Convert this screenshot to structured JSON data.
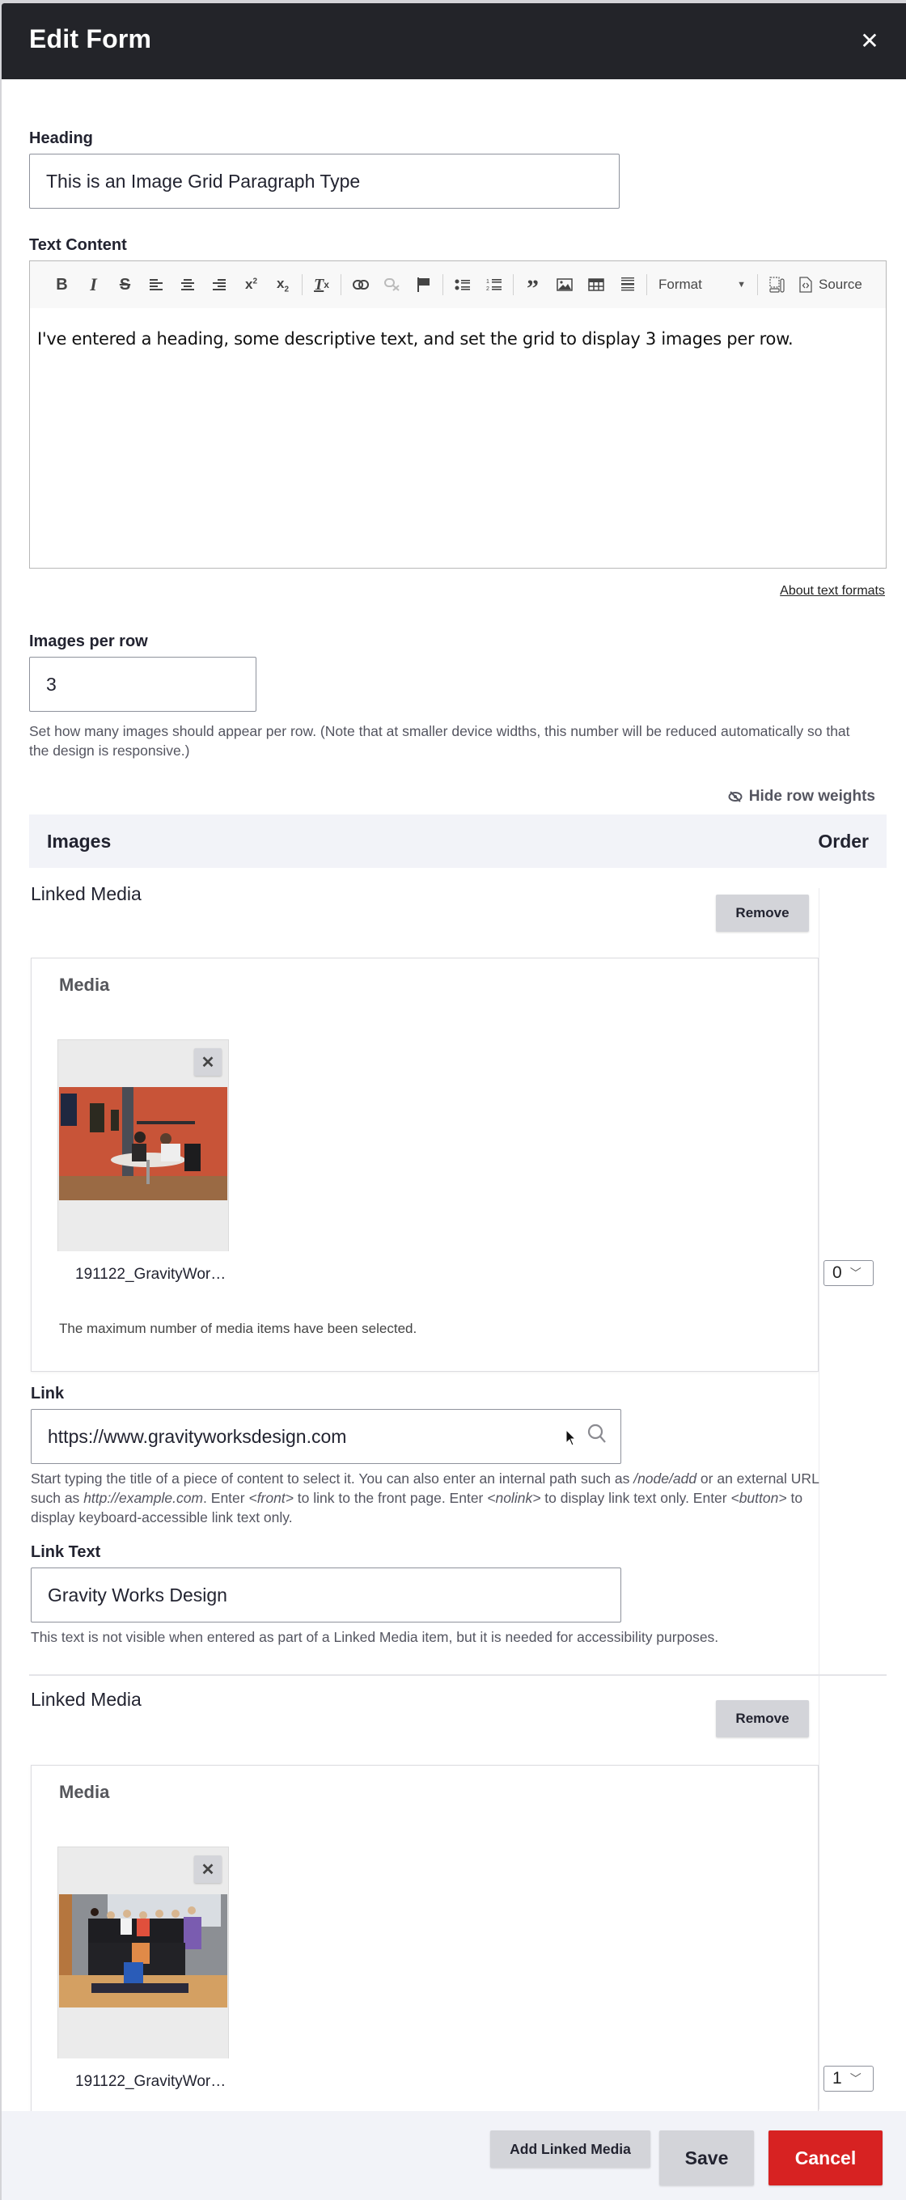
{
  "dialog": {
    "title": "Edit Form",
    "close_icon": "close-icon"
  },
  "heading": {
    "label": "Heading",
    "value": "This is an Image Grid Paragraph Type"
  },
  "text_content": {
    "label": "Text Content",
    "toolbar": [
      {
        "name": "bold",
        "glyph": "B"
      },
      {
        "name": "italic",
        "glyph": "I"
      },
      {
        "name": "strikethrough",
        "glyph": "S"
      },
      {
        "name": "align-left",
        "glyph": "≡"
      },
      {
        "name": "align-center",
        "glyph": "≡"
      },
      {
        "name": "align-right",
        "glyph": "≡"
      },
      {
        "name": "superscript",
        "glyph": "x²"
      },
      {
        "name": "subscript",
        "glyph": "x₂"
      },
      {
        "name": "remove-format",
        "glyph": "Tx"
      },
      {
        "name": "link",
        "glyph": "🔗"
      },
      {
        "name": "unlink",
        "glyph": "⛓"
      },
      {
        "name": "anchor",
        "glyph": "⚑"
      },
      {
        "name": "bulleted-list",
        "glyph": "•≡"
      },
      {
        "name": "numbered-list",
        "glyph": "1≡"
      },
      {
        "name": "blockquote",
        "glyph": "❞"
      },
      {
        "name": "image",
        "glyph": "▨"
      },
      {
        "name": "table",
        "glyph": "▦"
      },
      {
        "name": "horizontal-line",
        "glyph": "☰"
      }
    ],
    "format_label": "Format",
    "source_label": "Source",
    "body": "I've entered a heading, some descriptive text, and set the grid to display 3 images per row.",
    "about_link": "About text formats"
  },
  "images_per_row": {
    "label": "Images per row",
    "value": "3",
    "description": "Set how many images should appear per row. (Note that at smaller device widths, this number will be reduced automatically so that the design is responsive.)"
  },
  "images_table": {
    "hide_weights_label": "Hide row weights",
    "col_images": "Images",
    "col_order": "Order",
    "items": [
      {
        "type_label": "Linked Media",
        "remove_label": "Remove",
        "media_title": "Media",
        "thumb_name": "191122_GravityWor…",
        "remove_media_glyph": "✕",
        "max_note": "The maximum number of media items have been selected.",
        "order": "0",
        "link_label": "Link",
        "link_value": "https://www.gravityworksdesign.com",
        "link_desc_parts": {
          "p1": "Start typing the title of a piece of content to select it. You can also enter an internal path such as ",
          "i1": "/node/add",
          "p2": " or an external URL such as ",
          "i2": "http://example.com",
          "p3": ". Enter ",
          "i3": "<front>",
          "p4": " to link to the front page. Enter ",
          "i4": "<nolink>",
          "p5": " to display link text only. Enter ",
          "i5": "<button>",
          "p6": " to display keyboard-accessible link text only."
        },
        "link_text_label": "Link Text",
        "link_text_value": "Gravity Works Design",
        "link_text_desc": "This text is not visible when entered as part of a Linked Media item, but it is needed for accessibility purposes."
      },
      {
        "type_label": "Linked Media",
        "remove_label": "Remove",
        "media_title": "Media",
        "thumb_name": "191122_GravityWor…",
        "remove_media_glyph": "✕",
        "order": "1"
      }
    ]
  },
  "footer": {
    "add_label": "Add Linked Media",
    "save_label": "Save",
    "cancel_label": "Cancel"
  },
  "colors": {
    "header_bg": "#232429",
    "cancel_red": "#d72222",
    "button_gray": "#d3d4d9",
    "table_head_bg": "#f2f3f8"
  }
}
